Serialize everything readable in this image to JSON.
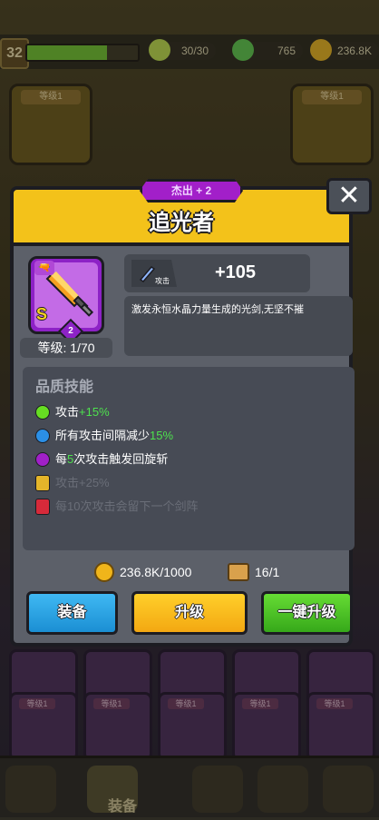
{
  "hud": {
    "player_level": "32",
    "xp_progress": 0.72,
    "energy": "30/30",
    "gems": "765",
    "gold": "236.8K"
  },
  "background_slots": {
    "left_label": "等级1",
    "right_label": "等级1",
    "grid_tag": "等级1"
  },
  "bottom_nav": {
    "active_label": "装备"
  },
  "modal": {
    "rarity": "杰出 + 2",
    "title": "追光者",
    "close_glyph": "✕",
    "item": {
      "grade": "S",
      "stars": "2",
      "level_label": "等级: 1/70"
    },
    "stat": {
      "icon_label": "攻击",
      "value": "+105"
    },
    "description": "激发永恒水晶力量生成的光剑,无坚不摧",
    "skills_title": "品质技能",
    "skills": [
      {
        "prefix": "攻击",
        "highlight": "+15%",
        "suffix": "",
        "color": "#66dd22",
        "locked": false
      },
      {
        "prefix": "所有攻击间隔减少",
        "highlight": "15%",
        "suffix": "",
        "color": "#2b8fe6",
        "locked": false
      },
      {
        "prefix": "每",
        "highlight": "5",
        "suffix": "次攻击触发回旋斩",
        "color": "#a020c8",
        "locked": false
      },
      {
        "text": "攻击+25%",
        "lock_color": "#e4b52a",
        "locked": true
      },
      {
        "text": "每10次攻击会留下一个剑阵",
        "lock_color": "#d62a3a",
        "locked": true
      }
    ],
    "cost": {
      "gold": "236.8K/1000",
      "scrolls": "16/1"
    },
    "buttons": {
      "equip": "装备",
      "upgrade": "升级",
      "one_key_upgrade": "一键升级"
    }
  }
}
